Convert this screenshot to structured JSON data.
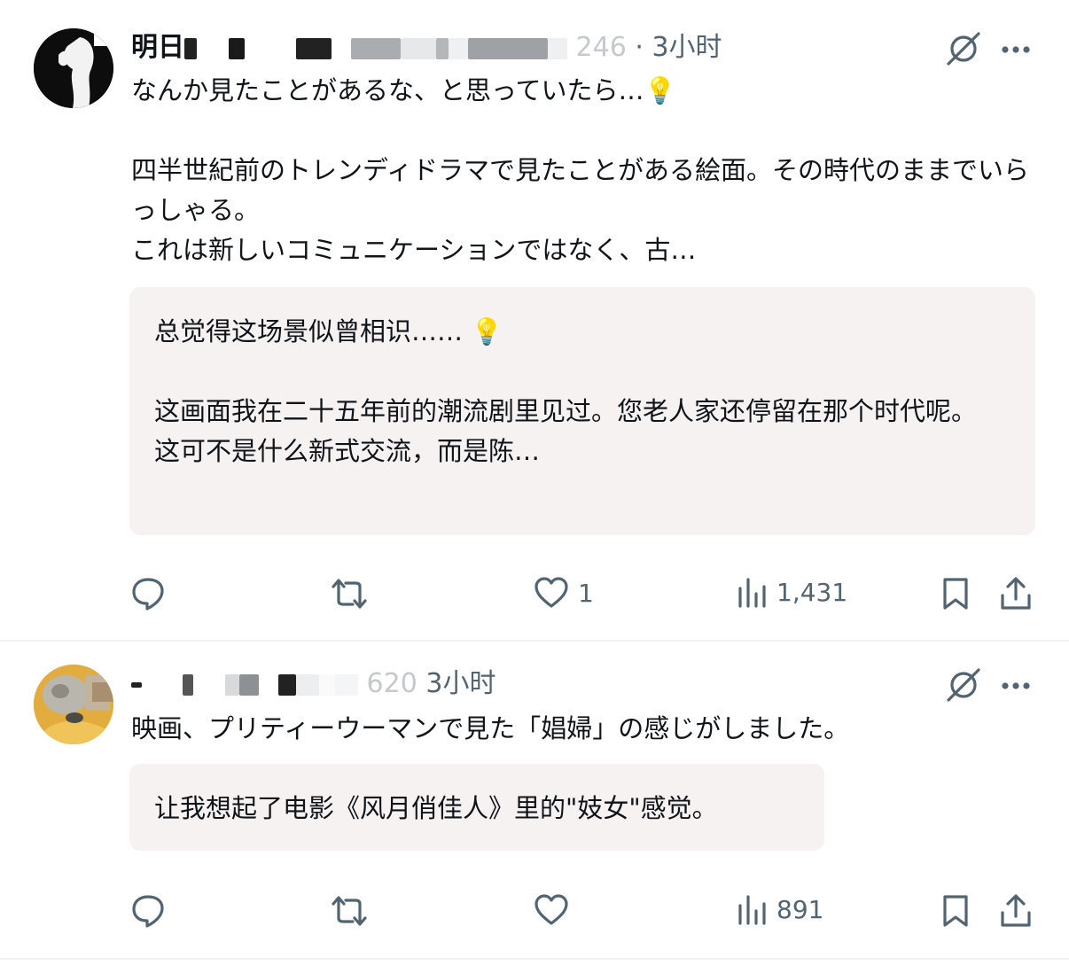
{
  "tweets": [
    {
      "author_visible": "明日",
      "handle_fragment": "246",
      "separator": "·",
      "time": "3小时",
      "text": "なんか見たことがあるな、と思っていたら…💡\n\n四半世紀前のトレンディドラマで見たことがある絵面。その時代のままでいらっしゃる。\nこれは新しいコミュニケーションではなく、古…",
      "translation": "总觉得这场景似曾相识…… 💡\n\n这画面我在二十五年前的潮流剧里见过。您老人家还停留在那个时代呢。\n这可不是什么新式交流，而是陈…",
      "likes": "1",
      "views": "1,431",
      "icons": [
        "reply-icon",
        "retweet-icon",
        "like-icon",
        "views-icon",
        "bookmark-icon",
        "share-icon",
        "grok-icon",
        "more-icon"
      ]
    },
    {
      "author_visible": "",
      "handle_fragment": "620",
      "separator": "",
      "time": "3小时",
      "text": "映画、プリティーウーマンで見た「娼婦」の感じがしました。",
      "translation": "让我想起了电影《风月俏佳人》里的\"妓女\"感觉。",
      "likes": "",
      "views": "891",
      "icons": [
        "reply-icon",
        "retweet-icon",
        "like-icon",
        "views-icon",
        "bookmark-icon",
        "share-icon",
        "grok-icon",
        "more-icon"
      ]
    }
  ],
  "colors": {
    "text": "#0f1419",
    "secondary": "#536471",
    "translation_bg": "#f7f2f2",
    "divider": "#eff3f4"
  }
}
